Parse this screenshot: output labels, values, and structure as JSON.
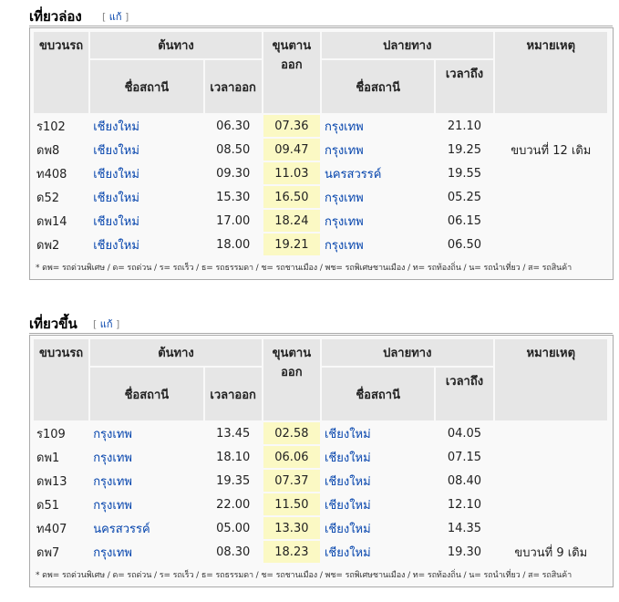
{
  "sections": [
    {
      "title": "เที่ยวล่อง",
      "edit_label": "แก้",
      "headers": {
        "train": "ขบวนรถ",
        "origin": "ต้นทาง",
        "khuntan": "ขุนตาน ออก",
        "destination": "ปลายทาง",
        "note": "หมายเหตุ",
        "station_name": "ชื่อสถานี",
        "depart_time": "เวลาออก",
        "arrive_time": "เวลาถึง"
      },
      "rows": [
        {
          "train": "ร102",
          "origin": "เชียงใหม่",
          "dep": "06.30",
          "khuntan": "07.36",
          "dest": "กรุงเทพ",
          "arr": "21.10",
          "note": ""
        },
        {
          "train": "ดพ8",
          "origin": "เชียงใหม่",
          "dep": "08.50",
          "khuntan": "09.47",
          "dest": "กรุงเทพ",
          "arr": "19.25",
          "note": "ขบวนที่ 12 เดิม"
        },
        {
          "train": "ท408",
          "origin": "เชียงใหม่",
          "dep": "09.30",
          "khuntan": "11.03",
          "dest": "นครสวรรค์",
          "arr": "19.55",
          "note": ""
        },
        {
          "train": "ด52",
          "origin": "เชียงใหม่",
          "dep": "15.30",
          "khuntan": "16.50",
          "dest": "กรุงเทพ",
          "arr": "05.25",
          "note": ""
        },
        {
          "train": "ดพ14",
          "origin": "เชียงใหม่",
          "dep": "17.00",
          "khuntan": "18.24",
          "dest": "กรุงเทพ",
          "arr": "06.15",
          "note": ""
        },
        {
          "train": "ดพ2",
          "origin": "เชียงใหม่",
          "dep": "18.00",
          "khuntan": "19.21",
          "dest": "กรุงเทพ",
          "arr": "06.50",
          "note": ""
        }
      ],
      "footnote": "* ดพ= รถด่วนพิเศษ / ด= รถด่วน / ร= รถเร็ว / ธ= รถธรรมดา / ช= รถชานเมือง / พช= รถพิเศษชานเมือง / ท= รถท้องถิ่น / น= รถนำเที่ยว / ส= รถสินค้า"
    },
    {
      "title": "เที่ยวขึ้น",
      "edit_label": "แก้",
      "headers": {
        "train": "ขบวนรถ",
        "origin": "ต้นทาง",
        "khuntan": "ขุนตาน ออก",
        "destination": "ปลายทาง",
        "note": "หมายเหตุ",
        "station_name": "ชื่อสถานี",
        "depart_time": "เวลาออก",
        "arrive_time": "เวลาถึง"
      },
      "rows": [
        {
          "train": "ร109",
          "origin": "กรุงเทพ",
          "dep": "13.45",
          "khuntan": "02.58",
          "dest": "เชียงใหม่",
          "arr": "04.05",
          "note": ""
        },
        {
          "train": "ดพ1",
          "origin": "กรุงเทพ",
          "dep": "18.10",
          "khuntan": "06.06",
          "dest": "เชียงใหม่",
          "arr": "07.15",
          "note": ""
        },
        {
          "train": "ดพ13",
          "origin": "กรุงเทพ",
          "dep": "19.35",
          "khuntan": "07.37",
          "dest": "เชียงใหม่",
          "arr": "08.40",
          "note": ""
        },
        {
          "train": "ด51",
          "origin": "กรุงเทพ",
          "dep": "22.00",
          "khuntan": "11.50",
          "dest": "เชียงใหม่",
          "arr": "12.10",
          "note": ""
        },
        {
          "train": "ท407",
          "origin": "นครสวรรค์",
          "dep": "05.00",
          "khuntan": "13.30",
          "dest": "เชียงใหม่",
          "arr": "14.35",
          "note": ""
        },
        {
          "train": "ดพ7",
          "origin": "กรุงเทพ",
          "dep": "08.30",
          "khuntan": "18.23",
          "dest": "เชียงใหม่",
          "arr": "19.30",
          "note": "ขบวนที่ 9 เดิม"
        }
      ],
      "footnote": "* ดพ= รถด่วนพิเศษ / ด= รถด่วน / ร= รถเร็ว / ธ= รถธรรมดา / ช= รถชานเมือง / พช= รถพิเศษชานเมือง / ท= รถท้องถิ่น / น= รถนำเที่ยว / ส= รถสินค้า"
    }
  ]
}
